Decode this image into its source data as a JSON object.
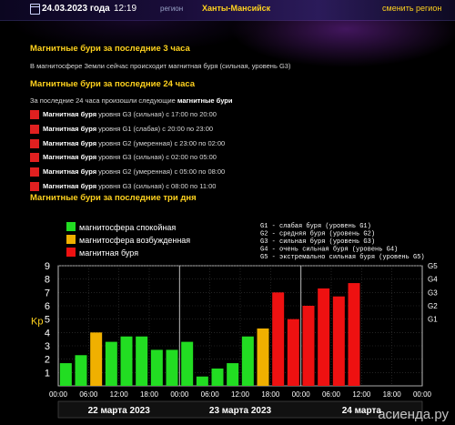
{
  "header": {
    "date": "24.03.2023 года",
    "time": "12:19",
    "region_label": "регион",
    "region_name": "Ханты-Мансийск",
    "change_region": "сменить регион",
    "calendar_icon": "calendar-icon"
  },
  "last3h": {
    "title": "Магнитные бури за последние 3 часа",
    "text": "В магнитосфере Земли сейчас происходит магнитная буря (сильная, уровень G3)"
  },
  "last24h": {
    "title": "Магнитные бури за последние 24 часа",
    "intro": "За последние 24 часа произошли следующие",
    "intro_bold": "магнитные бури",
    "items": [
      {
        "name": "Магнитная буря",
        "detail": " уровня G3 (сильная) с 17:00 по 20:00"
      },
      {
        "name": "Магнитная буря",
        "detail": " уровня G1 (слабая) с 20:00 по 23:00"
      },
      {
        "name": "Магнитная буря",
        "detail": " уровня G2 (умеренная) с 23:00 по 02:00"
      },
      {
        "name": "Магнитная буря",
        "detail": " уровня G3 (сильная) с 02:00 по 05:00"
      },
      {
        "name": "Магнитная буря",
        "detail": " уровня G2 (умеренная) с 05:00 по 08:00"
      },
      {
        "name": "Магнитная буря",
        "detail": " уровня G3 (сильная) с 08:00 по 11:00"
      }
    ],
    "item_color": "#e02020"
  },
  "chart_section_title": "Магнитные бури за последние три дня",
  "chart_data": {
    "type": "bar",
    "ylabel": "Kp",
    "ylim": [
      0,
      9
    ],
    "yticks": [
      1,
      2,
      3,
      4,
      5,
      6,
      7,
      8,
      9
    ],
    "right_ticks": [
      "G1",
      "G2",
      "G3",
      "G4",
      "G5"
    ],
    "legend_left": [
      {
        "label": "магнитосфера спокойная",
        "color": "#22dd22"
      },
      {
        "label": "магнитосфера возбужденная",
        "color": "#f0b000"
      },
      {
        "label": "магнитная буря",
        "color": "#ee1111"
      }
    ],
    "legend_right": [
      "G1 - слабая буря (уровень G1)",
      "G2 - средняя буря (уровень G2)",
      "G3 - сильная буря (уровень G3)",
      "G4 - очень сильная буря (уровень G4)",
      "G5 - экстремально сильная буря (уровень G5)"
    ],
    "xtick_labels": [
      "00:00",
      "06:00",
      "12:00",
      "18:00",
      "00:00",
      "06:00",
      "12:00",
      "18:00",
      "00:00",
      "06:00",
      "12:00",
      "18:00",
      "00:00"
    ],
    "day_labels": [
      "22 марта 2023",
      "23 марта 2023",
      "24 марта"
    ],
    "values": [
      1.7,
      2.3,
      4.0,
      3.3,
      3.7,
      3.7,
      2.7,
      2.7,
      3.3,
      0.7,
      1.3,
      1.7,
      3.7,
      4.3,
      7.0,
      5.0,
      6.0,
      7.3,
      6.7,
      7.7
    ],
    "status": [
      "quiet",
      "quiet",
      "active",
      "quiet",
      "quiet",
      "quiet",
      "quiet",
      "quiet",
      "quiet",
      "quiet",
      "quiet",
      "quiet",
      "quiet",
      "active",
      "storm",
      "storm",
      "storm",
      "storm",
      "storm",
      "storm"
    ],
    "colors": {
      "quiet": "#22dd22",
      "active": "#f0b000",
      "storm": "#ee1111"
    },
    "grid": true
  },
  "watermark": "асиенда.ру"
}
